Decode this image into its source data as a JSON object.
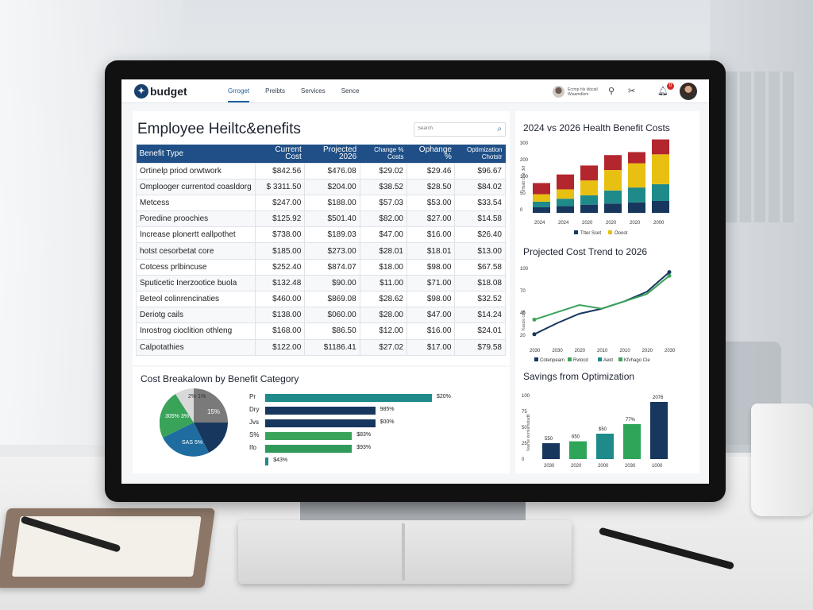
{
  "app": {
    "logo_text": "budget",
    "nav": [
      "Grroget",
      "Preibts",
      "Services",
      "Sence"
    ],
    "active_nav": 0,
    "user_name_lines": [
      "Ecrmp hls lsbcatl",
      "Wiaamdlem"
    ],
    "notification_count": "0"
  },
  "icons": {
    "logo": "logo-mark-icon",
    "search": "search-icon",
    "location": "location-pin-icon",
    "tools": "tools-icon",
    "bell": "bell-icon"
  },
  "page": {
    "title": "Employee Heiltc&enefits",
    "search_placeholder": "Search"
  },
  "table": {
    "headers": [
      "Benefit Type",
      "Current Cost",
      "Projected 2026",
      "Change % Costs",
      "Ophange %",
      "Optimization Chotstr"
    ],
    "rows": [
      [
        "Ortinelp priod orwtwork",
        "$842.56",
        "$476.08",
        "$29.02",
        "$29.46",
        "$96.67"
      ],
      [
        "Omplooger currentod coasldorg",
        "$ 3311.50",
        "$204.00",
        "$38.52",
        "$28.50",
        "$84.02"
      ],
      [
        "Metcess",
        "$247.00",
        "$188.00",
        "$57.03",
        "$53.00",
        "$33.54"
      ],
      [
        "Poredine proochies",
        "$125.92",
        "$501.40",
        "$82.00",
        "$27.00",
        "$14.58"
      ],
      [
        "Increase plonertt eallpothet",
        "$738.00",
        "$189.03",
        "$47.00",
        "$16.00",
        "$26.40"
      ],
      [
        "hotst cesorbetat core",
        "$185.00",
        "$273.00",
        "$28.01",
        "$18.01",
        "$13.00"
      ],
      [
        "Cotcess prlbincuse",
        "$252.40",
        "$874.07",
        "$18.00",
        "$98.00",
        "$67.58"
      ],
      [
        "Sputicetic Inerzootice buola",
        "$132.48",
        "$90.00",
        "$11.00",
        "$71.00",
        "$18.08"
      ],
      [
        "Beteol colinrencinaties",
        "$460.00",
        "$869.08",
        "$28.62",
        "$98.00",
        "$32.52"
      ],
      [
        "Deriotg cails",
        "$138.00",
        "$060.00",
        "$28.00",
        "$47.00",
        "$14.24"
      ],
      [
        "Inrostrog cioclition othleng",
        "$168.00",
        "$86.50",
        "$12.00",
        "$16.00",
        "$24.01"
      ],
      [
        "Calpotathies",
        "$122.00",
        "$1186.41",
        "$27.02",
        "$17.00",
        "$79.58"
      ]
    ]
  },
  "breakdown": {
    "title": "Cost Breakalown by Benefit Category",
    "pie_labels": [
      "2% 1%",
      "15%",
      "305% 3%",
      "SAS 5%"
    ],
    "bars": [
      {
        "label": "Pr",
        "value": "$20%",
        "fraction": 1.0,
        "color": "#1f8a8a"
      },
      {
        "label": "Dry",
        "value": "985%",
        "fraction": 0.66,
        "color": "#17375e"
      },
      {
        "label": "Jvs",
        "value": "$00%",
        "fraction": 0.66,
        "color": "#17375e"
      },
      {
        "label": "S%",
        "value": "$83%",
        "fraction": 0.52,
        "color": "#3aa35a"
      },
      {
        "label": "Ifo",
        "value": "$93%",
        "fraction": 0.52,
        "color": "#2f9a59"
      },
      {
        "label": "",
        "value": "$43%",
        "fraction": 0.02,
        "color": "#1f8a8a"
      }
    ]
  },
  "colors": {
    "navy": "#17375e",
    "teal": "#1f8a8a",
    "green": "#3aa35a",
    "gold": "#e8c012",
    "red": "#b3262e",
    "header_blue": "#1f4f86"
  },
  "chart_data": [
    {
      "type": "bar",
      "title": "2024 vs 2026 Health Benefit Costs",
      "categories": [
        "2024",
        "2024",
        "2020",
        "2020",
        "2020",
        "2000"
      ],
      "ylim": [
        0,
        300
      ],
      "y_ticks": [
        "300",
        "200",
        "100",
        "50",
        "0"
      ],
      "series": [
        {
          "name": "Ttter Scet",
          "values": [
            15,
            18,
            22,
            25,
            28,
            32
          ],
          "color": "#17375e"
        },
        {
          "name": "",
          "values": [
            15,
            20,
            25,
            35,
            40,
            45
          ],
          "color": "#1f8a8a"
        },
        {
          "name": "Oooot",
          "values": [
            20,
            25,
            40,
            55,
            65,
            80
          ],
          "color": "#e8c012"
        },
        {
          "name": "",
          "values": [
            30,
            40,
            40,
            40,
            30,
            40
          ],
          "color": "#b3262e"
        }
      ],
      "legend": "bottom",
      "ylabel": "Hbatt cost, $d"
    },
    {
      "type": "line",
      "title": "Projected Cost Trend to 2026",
      "x": [
        "2030",
        "2030",
        "2020",
        "2010",
        "2010",
        "2020",
        "2030"
      ],
      "y_ticks": [
        "100",
        "70",
        "40",
        "20"
      ],
      "series": [
        {
          "name": "Cotenpeam",
          "values": [
            10,
            25,
            38,
            45,
            55,
            68,
            95
          ],
          "color": "#17375e"
        },
        {
          "name": "Rvtocd",
          "values": [
            30,
            40,
            50,
            45,
            55,
            65,
            90
          ],
          "color": "#3aa35a"
        },
        {
          "name": "Aekt",
          "values": [],
          "color": "#1f8a8a"
        },
        {
          "name": "Kfvhago Cie",
          "values": [],
          "color": "#3aa35a"
        }
      ],
      "legend": "bottom",
      "ylabel": "Kaszie cost"
    },
    {
      "type": "bar",
      "title": "Savings from Optimization",
      "categories": [
        "2030",
        "2020",
        "2000",
        "2030",
        "1000"
      ],
      "y_ticks": [
        "100",
        "75",
        "50",
        "25",
        "0"
      ],
      "values": [
        25,
        28,
        40,
        55,
        90
      ],
      "value_labels": [
        "550",
        "650",
        "$50",
        "77%",
        "2076"
      ],
      "colors": [
        "#17375e",
        "#2fa55a",
        "#1f8a8a",
        "#2fa55a",
        "#17375e"
      ],
      "ylabel": "Vasme kornlamotadlt"
    }
  ]
}
